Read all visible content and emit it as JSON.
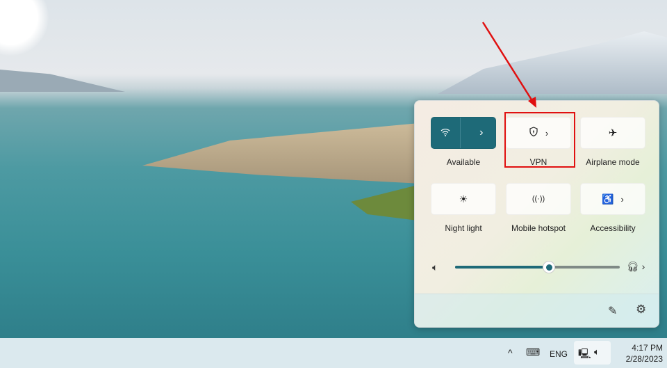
{
  "quick_settings": {
    "tiles": [
      {
        "label": "Available",
        "icon": "wifi-icon",
        "active": true,
        "has_chevron": true
      },
      {
        "label": "VPN",
        "icon": "shield-icon",
        "active": false,
        "has_chevron": true
      },
      {
        "label": "Airplane mode",
        "icon": "airplane-icon",
        "active": false,
        "has_chevron": false
      },
      {
        "label": "Night light",
        "icon": "night-light-icon",
        "active": false,
        "has_chevron": false
      },
      {
        "label": "Mobile hotspot",
        "icon": "hotspot-icon",
        "active": false,
        "has_chevron": false
      },
      {
        "label": "Accessibility",
        "icon": "accessibility-icon",
        "active": false,
        "has_chevron": true
      }
    ],
    "volume_percent": 57,
    "accent_color": "#1e6a78",
    "annotation_color": "#e01010"
  },
  "taskbar": {
    "language": "ENG",
    "time": "4:17 PM",
    "date": "2/28/2023"
  }
}
